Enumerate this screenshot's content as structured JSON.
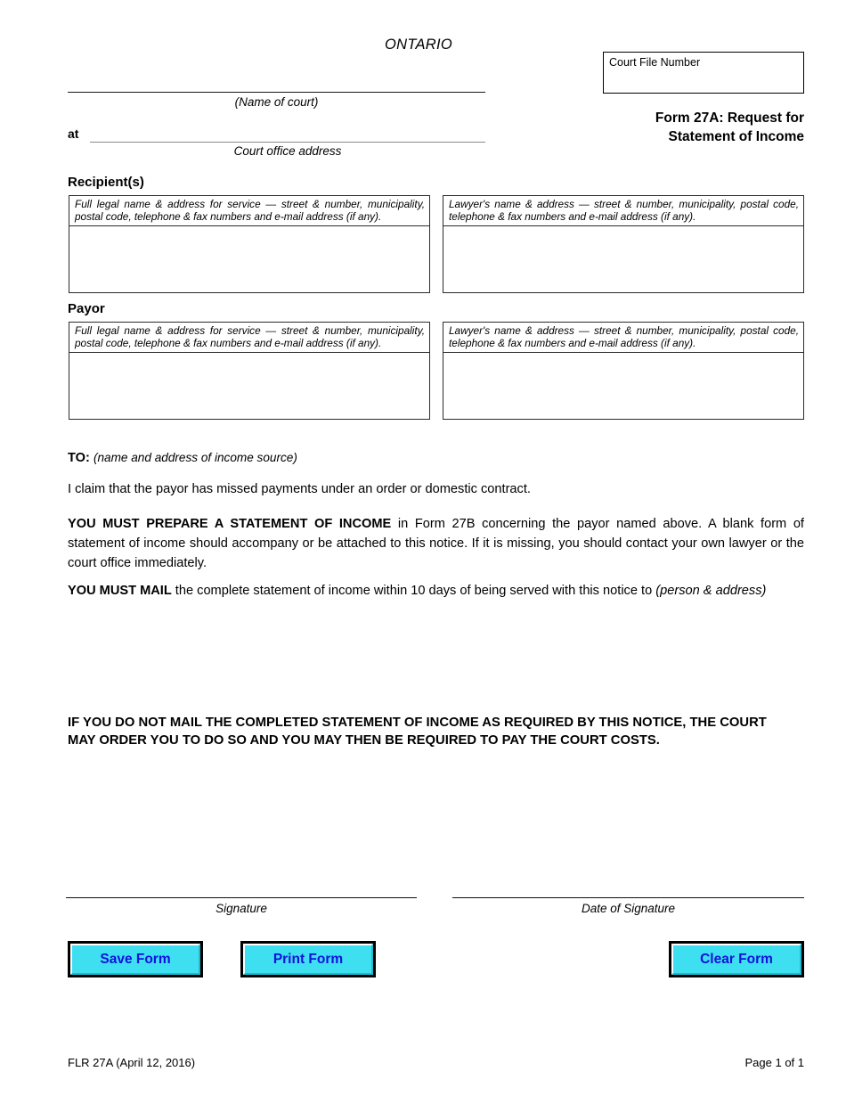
{
  "header": {
    "jurisdiction": "ONTARIO",
    "court_file_number_label": "Court File Number",
    "court_file_number_value": "",
    "form_title_line1": "Form 27A:  Request for",
    "form_title_line2": "Statement of Income",
    "court_name_value": "",
    "court_name_caption": "(Name of court)",
    "at_label": "at",
    "court_address_value": "",
    "court_address_caption": "Court office address"
  },
  "parties": {
    "recipient_heading": "Recipient(s)",
    "payor_heading": "Payor",
    "party_caption": "Full legal name & address for service — street & number, municipality, postal code, telephone & fax numbers and e-mail address (if any).",
    "lawyer_caption": "Lawyer's name & address — street & number, municipality, postal code, telephone & fax numbers and e-mail address (if any).",
    "recipient_party_value": "",
    "recipient_lawyer_value": "",
    "payor_party_value": "",
    "payor_lawyer_value": ""
  },
  "body": {
    "to_label": "TO:",
    "to_hint": "(name and address of income source)",
    "to_value": "",
    "claim_text": "I claim that the payor has missed payments under an order or domestic contract.",
    "prepare_bold": "YOU MUST PREPARE A STATEMENT OF INCOME",
    "prepare_rest": " in Form 27B concerning the payor named above.  A blank form of statement of income should accompany or be attached to this notice.  If it is missing, you should contact your own lawyer or the court office immediately.",
    "mail_bold": "YOU MUST MAIL",
    "mail_rest": " the complete statement of income within 10 days of being served with this notice to ",
    "mail_hint": "(person & address)",
    "mail_value": "",
    "warning_text": "IF YOU DO NOT MAIL THE COMPLETED STATEMENT OF INCOME AS REQUIRED BY THIS NOTICE, THE COURT MAY ORDER YOU TO DO SO AND YOU MAY THEN BE REQUIRED TO PAY THE COURT COSTS."
  },
  "signature": {
    "signature_caption": "Signature",
    "date_caption": "Date of Signature",
    "signature_value": "",
    "date_value": ""
  },
  "buttons": {
    "save_label": "Save Form",
    "print_label": "Print Form",
    "clear_label": "Clear Form",
    "face_color": "#3fdff2",
    "text_color": "#1111dd",
    "border_color": "#000000"
  },
  "footer": {
    "form_code": "FLR 27A (April 12, 2016)",
    "page_number": "Page 1 of 1"
  }
}
